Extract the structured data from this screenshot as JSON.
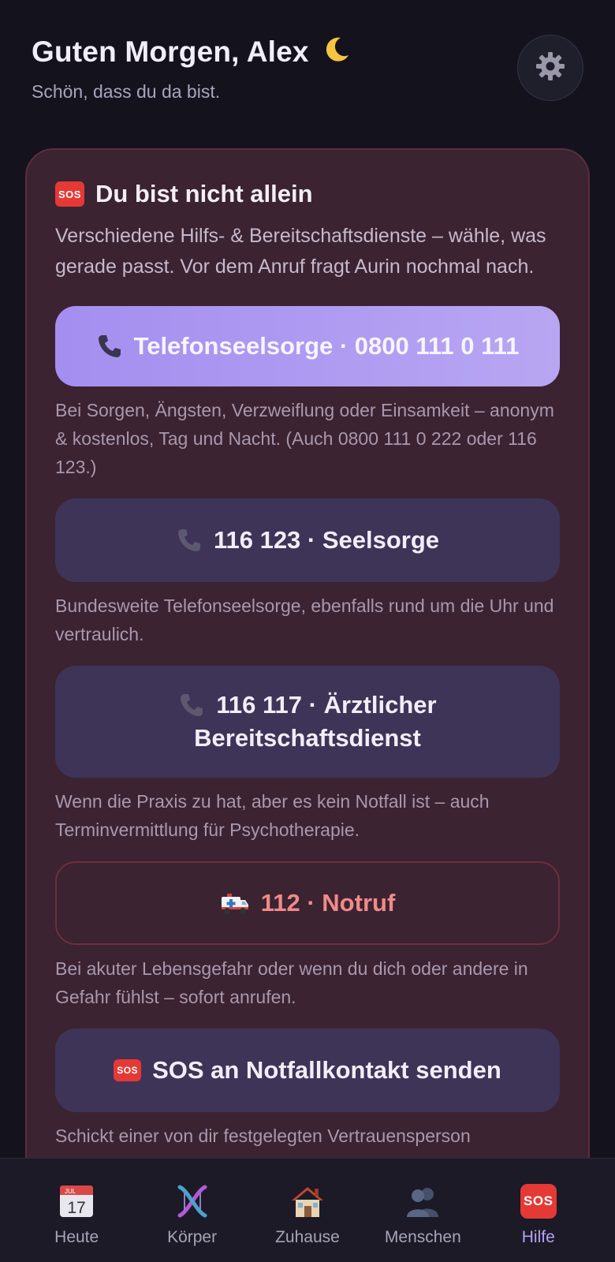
{
  "header": {
    "greeting": "Guten Morgen, Alex",
    "greeting_icon": "moon-icon",
    "subtitle": "Schön, dass du da bist.",
    "settings_icon": "gear-icon"
  },
  "card": {
    "title_icon": "sos-icon",
    "title_badge": "SOS",
    "title": "Du bist nicht allein",
    "description": "Verschiedene Hilfs- & Bereitschaftsdienste – wähle, was gerade passt. Vor dem Anruf fragt Aurin nochmal nach.",
    "services": [
      {
        "icon": "phone-icon",
        "label": "Telefonseelsorge · 0800 111 0 111",
        "help": "Bei Sorgen, Ängsten, Verzweiflung oder Einsamkeit – anonym & kostenlos, Tag und Nacht. (Auch 0800 111 0 222 oder 116 123.)"
      },
      {
        "icon": "phone-icon",
        "label": "116 123 · Seelsorge",
        "help": "Bundesweite Telefonseelsorge, ebenfalls rund um die Uhr und vertraulich."
      },
      {
        "icon": "phone-icon",
        "label_line1": "116 117 · Ärztlicher",
        "label_line2": "Bereitschaftsdienst",
        "help": "Wenn die Praxis zu hat, aber es kein Notfall ist – auch Terminvermittlung für Psychotherapie."
      },
      {
        "icon": "ambulance-icon",
        "label": "112 · Notruf",
        "help": "Bei akuter Lebensgefahr oder wenn du dich oder andere in Gefahr fühlst – sofort anrufen."
      },
      {
        "icon": "sos-icon",
        "badge": "SOS",
        "label": "SOS an Notfallkontakt senden",
        "help": "Schickt einer von dir festgelegten Vertrauensperson"
      }
    ]
  },
  "nav": {
    "items": [
      {
        "label": "Heute",
        "icon": "calendar-icon",
        "calendar_month": "JUL",
        "calendar_day": "17"
      },
      {
        "label": "Körper",
        "icon": "dna-icon"
      },
      {
        "label": "Zuhause",
        "icon": "house-icon"
      },
      {
        "label": "Menschen",
        "icon": "people-icon"
      },
      {
        "label": "Hilfe",
        "icon": "sos-icon",
        "badge": "SOS",
        "active": true
      }
    ]
  },
  "colors": {
    "background": "#14131d",
    "card": "#3b2331",
    "primary": "#a48ef0",
    "secondary_button": "#3e3458",
    "danger_text": "#f08a8a",
    "active_nav": "#b7a2f5"
  }
}
